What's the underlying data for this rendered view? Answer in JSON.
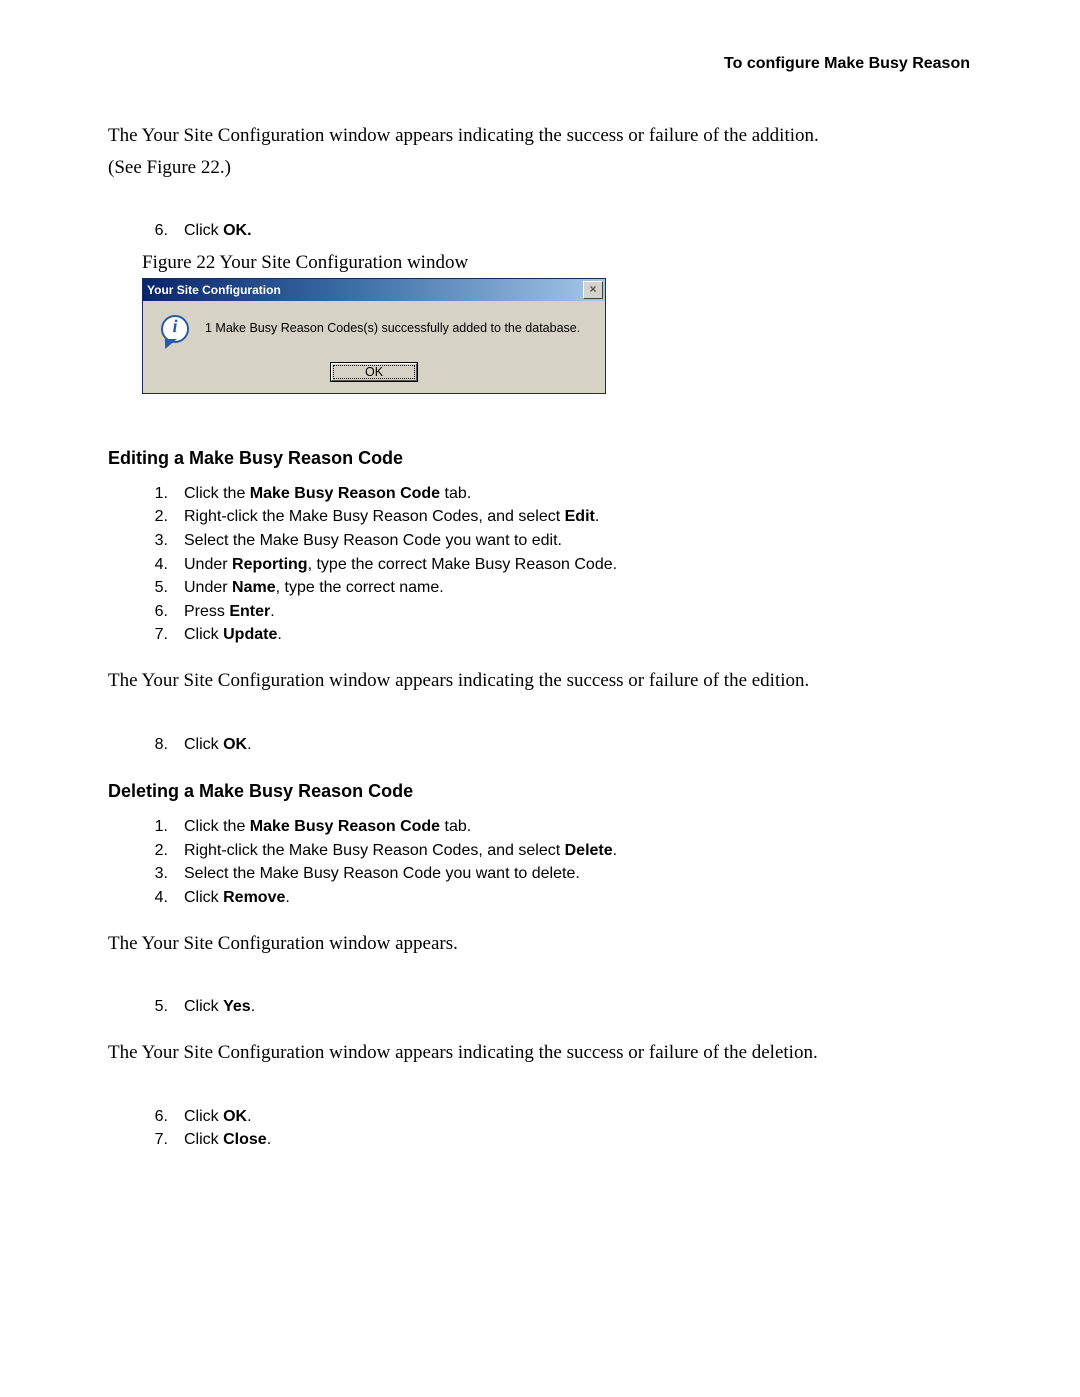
{
  "header": {
    "title": "To configure Make Busy Reason"
  },
  "intro": {
    "line1": "The Your Site Configuration window appears indicating the success or failure of the addition.",
    "line2": "(See Figure 22.)"
  },
  "step6": {
    "num": "6.",
    "prefix": "Click ",
    "bold": "OK."
  },
  "figure": {
    "caption": "Figure 22   Your Site Configuration window",
    "dialog": {
      "title": "Your Site Configuration",
      "close": "×",
      "message": "1 Make Busy Reason Codes(s) successfully added to the database.",
      "ok": "OK"
    }
  },
  "editing": {
    "heading": "Editing a Make Busy Reason Code",
    "steps": [
      {
        "num": "1.",
        "parts": [
          {
            "t": "Click the "
          },
          {
            "t": "Make Busy Reason Code",
            "b": true
          },
          {
            "t": " tab."
          }
        ]
      },
      {
        "num": "2.",
        "parts": [
          {
            "t": "Right-click the Make Busy Reason Codes, and select "
          },
          {
            "t": "Edit",
            "b": true
          },
          {
            "t": "."
          }
        ]
      },
      {
        "num": "3.",
        "parts": [
          {
            "t": "Select the Make Busy Reason Code you want to edit."
          }
        ]
      },
      {
        "num": "4.",
        "parts": [
          {
            "t": "Under "
          },
          {
            "t": "Reporting",
            "b": true
          },
          {
            "t": ", type the correct Make Busy Reason Code."
          }
        ]
      },
      {
        "num": "5.",
        "parts": [
          {
            "t": "Under "
          },
          {
            "t": "Name",
            "b": true
          },
          {
            "t": ", type the correct name."
          }
        ]
      },
      {
        "num": "6.",
        "parts": [
          {
            "t": "Press "
          },
          {
            "t": "Enter",
            "b": true
          },
          {
            "t": "."
          }
        ]
      },
      {
        "num": "7.",
        "parts": [
          {
            "t": "Click "
          },
          {
            "t": "Update",
            "b": true
          },
          {
            "t": "."
          }
        ]
      }
    ],
    "after": "The Your Site Configuration window appears indicating the success or failure of the edition.",
    "step8": {
      "num": "8.",
      "parts": [
        {
          "t": "Click "
        },
        {
          "t": "OK",
          "b": true
        },
        {
          "t": "."
        }
      ]
    }
  },
  "deleting": {
    "heading": "Deleting a Make Busy Reason Code",
    "stepsA": [
      {
        "num": "1.",
        "parts": [
          {
            "t": "Click the "
          },
          {
            "t": "Make Busy Reason Code",
            "b": true
          },
          {
            "t": " tab."
          }
        ]
      },
      {
        "num": "2.",
        "parts": [
          {
            "t": "Right-click the Make Busy Reason Codes, and select "
          },
          {
            "t": "Delete",
            "b": true
          },
          {
            "t": "."
          }
        ]
      },
      {
        "num": "3.",
        "parts": [
          {
            "t": "Select the Make Busy Reason Code you want to delete."
          }
        ]
      },
      {
        "num": "4.",
        "parts": [
          {
            "t": "Click "
          },
          {
            "t": "Remove",
            "b": true
          },
          {
            "t": "."
          }
        ]
      }
    ],
    "mid1": "The Your Site Configuration window appears.",
    "step5": {
      "num": "5.",
      "parts": [
        {
          "t": "Click "
        },
        {
          "t": "Yes",
          "b": true
        },
        {
          "t": "."
        }
      ]
    },
    "mid2": "The Your Site Configuration window appears indicating the success or failure of the deletion.",
    "stepsB": [
      {
        "num": "6.",
        "parts": [
          {
            "t": "Click "
          },
          {
            "t": "OK",
            "b": true
          },
          {
            "t": "."
          }
        ]
      },
      {
        "num": "7.",
        "parts": [
          {
            "t": "Click "
          },
          {
            "t": "Close",
            "b": true
          },
          {
            "t": "."
          }
        ]
      }
    ]
  }
}
